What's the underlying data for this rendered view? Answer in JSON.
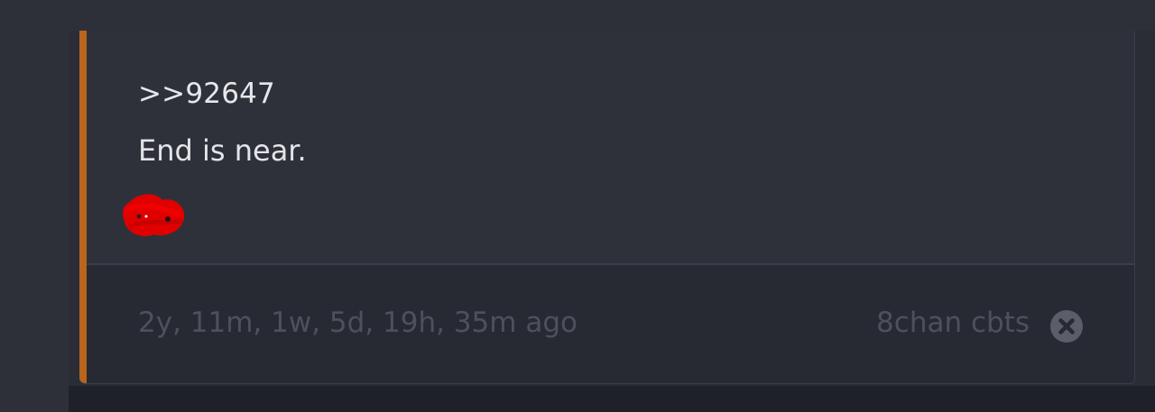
{
  "post": {
    "quote_link": ">>92647",
    "message": "End is near.",
    "timestamp": "2y, 11m, 1w, 5d, 19h, 35m ago",
    "source": "8chan cbts"
  },
  "icons": {
    "close": "close-circle-icon",
    "redaction": "red-scribble-mark"
  },
  "colors": {
    "accent": "#b9651f",
    "background": "#2e313a",
    "footer": "#272a32",
    "muted_text": "#4d515c",
    "redaction": "#e00000"
  }
}
